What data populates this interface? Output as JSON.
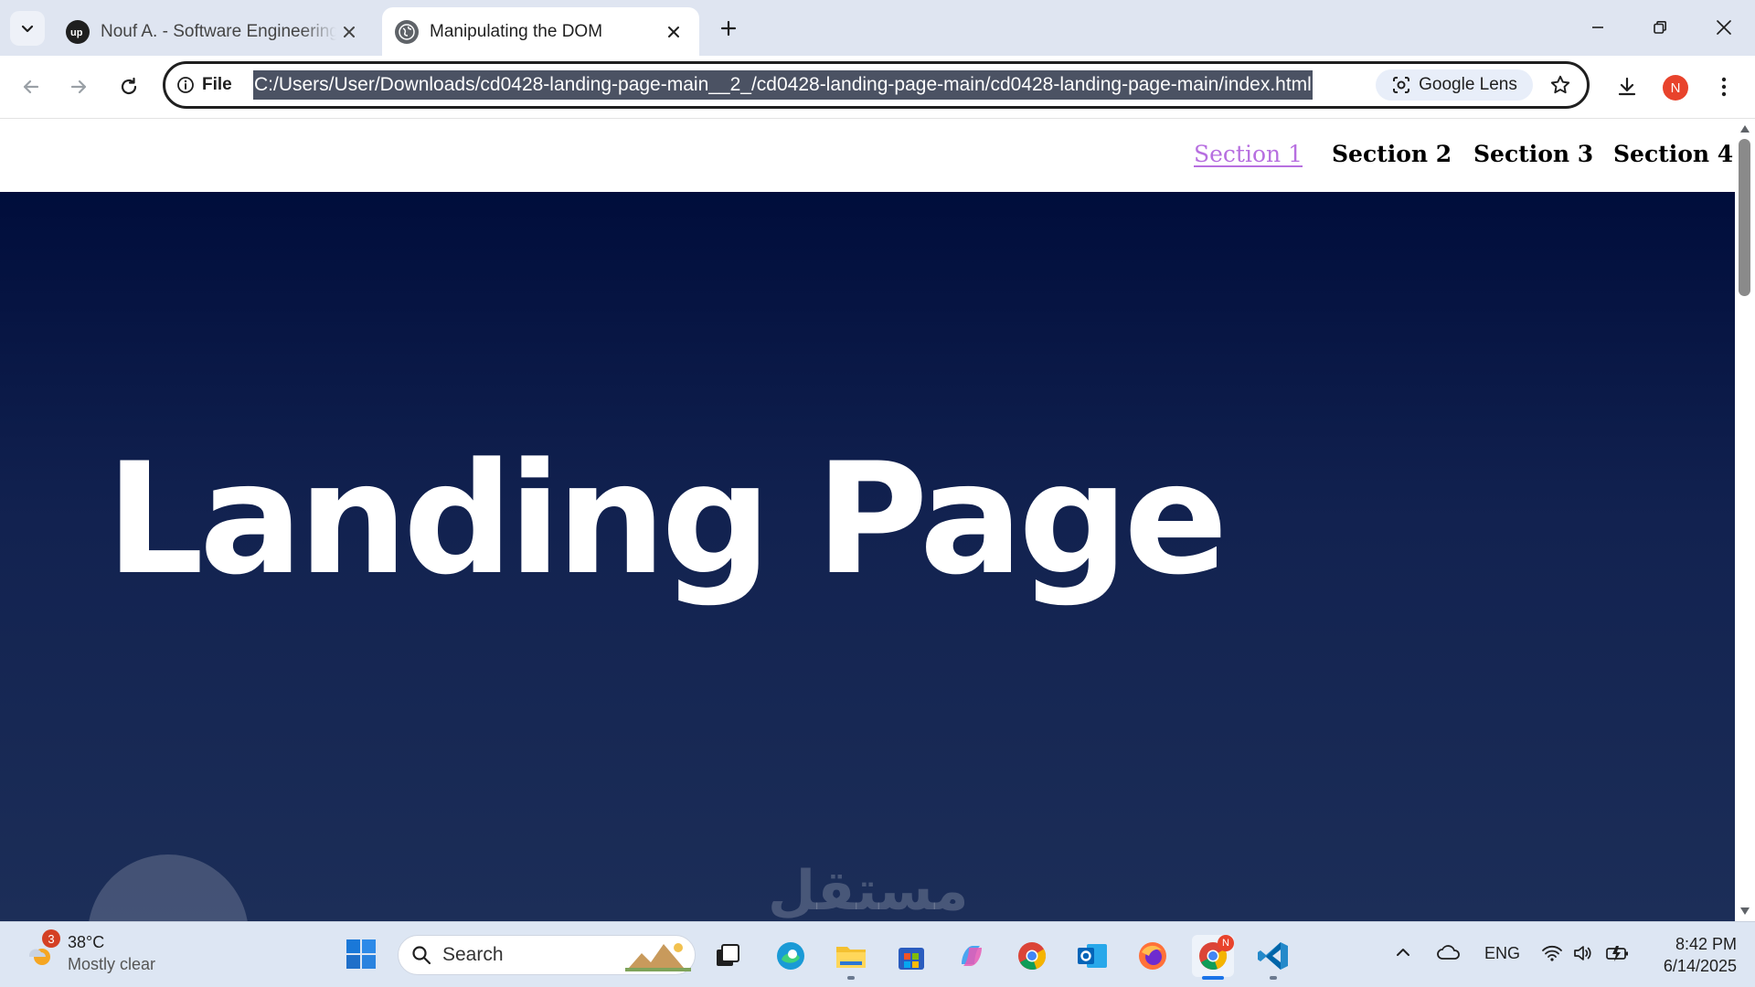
{
  "browser": {
    "tabs": [
      {
        "title": "Nouf A. - Software Engineering",
        "favicon": "upwork-icon",
        "active": false
      },
      {
        "title": "Manipulating the DOM",
        "favicon": "globe-icon",
        "active": true
      }
    ],
    "site_info_label": "File",
    "url": "C:/Users/User/Downloads/cd0428-landing-page-main__2_/cd0428-landing-page-main/cd0428-landing-page-main/index.html",
    "lens_label": "Google Lens",
    "profile_initial": "N"
  },
  "page": {
    "nav": [
      {
        "label": "Section 1",
        "active": true
      },
      {
        "label": "Section 2",
        "active": false
      },
      {
        "label": "Section 3",
        "active": false
      },
      {
        "label": "Section 4",
        "active": false
      }
    ],
    "hero_title": "Landing Page",
    "watermark": "مستقل"
  },
  "taskbar": {
    "weather": {
      "temp": "38°C",
      "condition": "Mostly clear",
      "badge": "3"
    },
    "search_placeholder": "Search",
    "language": "ENG",
    "time": "8:42 PM",
    "date": "6/14/2025",
    "chrome_badge": "N"
  },
  "colors": {
    "active_nav": "#b76fe0",
    "hero_top": "#000d3b",
    "hero_bottom": "#1c2e58"
  }
}
